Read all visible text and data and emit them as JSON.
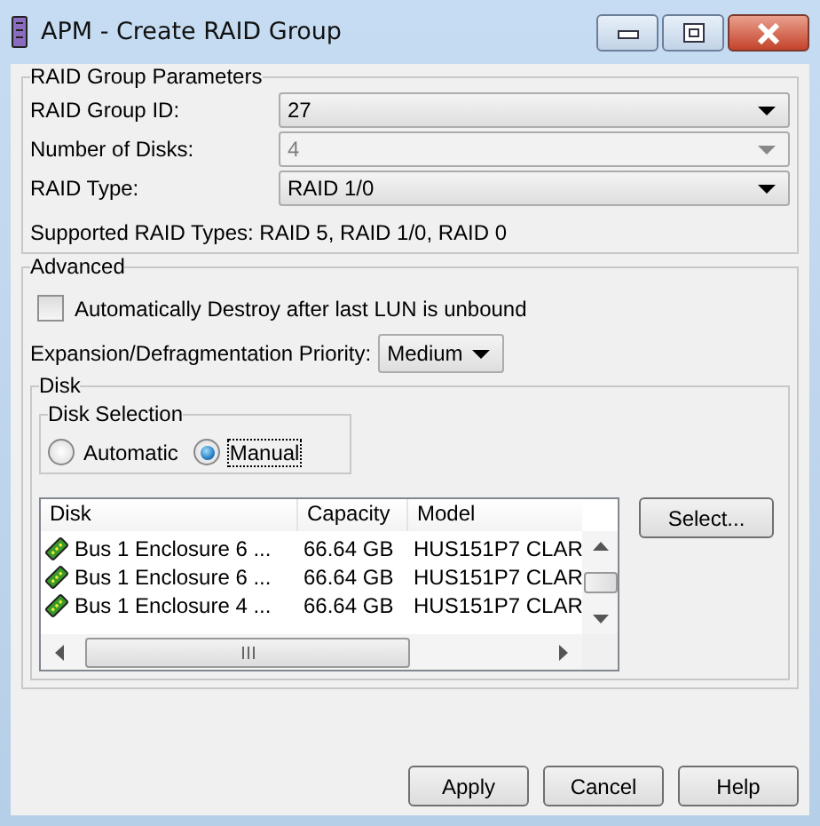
{
  "window": {
    "title": "APM - Create RAID Group"
  },
  "raid_group_parameters": {
    "title": "RAID Group Parameters",
    "fields": [
      {
        "label": "RAID Group ID:",
        "value": "27",
        "disabled": false
      },
      {
        "label": "Number of Disks:",
        "value": "4",
        "disabled": true
      },
      {
        "label": "RAID Type:",
        "value": "RAID 1/0",
        "disabled": false
      }
    ],
    "supported": "Supported RAID Types: RAID 5, RAID 1/0, RAID 0"
  },
  "advanced": {
    "title": "Advanced",
    "auto_destroy": {
      "label": "Automatically Destroy after last LUN is unbound",
      "checked": false
    },
    "priority": {
      "label": "Expansion/Defragmentation Priority:",
      "value": "Medium"
    },
    "disk": {
      "title": "Disk",
      "disk_selection": {
        "title": "Disk Selection",
        "options": [
          {
            "label": "Automatic",
            "selected": false,
            "focused": false
          },
          {
            "label": "Manual",
            "selected": true,
            "focused": true
          }
        ]
      },
      "table": {
        "columns": [
          "Disk",
          "Capacity",
          "Model"
        ],
        "rows": [
          [
            "Bus 1 Enclosure 6 ...",
            "66.64 GB",
            "HUS151P7 CLAR"
          ],
          [
            "Bus 1 Enclosure 6 ...",
            "66.64 GB",
            "HUS151P7 CLAR"
          ],
          [
            "Bus 1 Enclosure 4 ...",
            "66.64 GB",
            "HUS151P7 CLAR"
          ]
        ]
      },
      "select_button": "Select..."
    }
  },
  "buttons": [
    "Apply",
    "Cancel",
    "Help"
  ]
}
